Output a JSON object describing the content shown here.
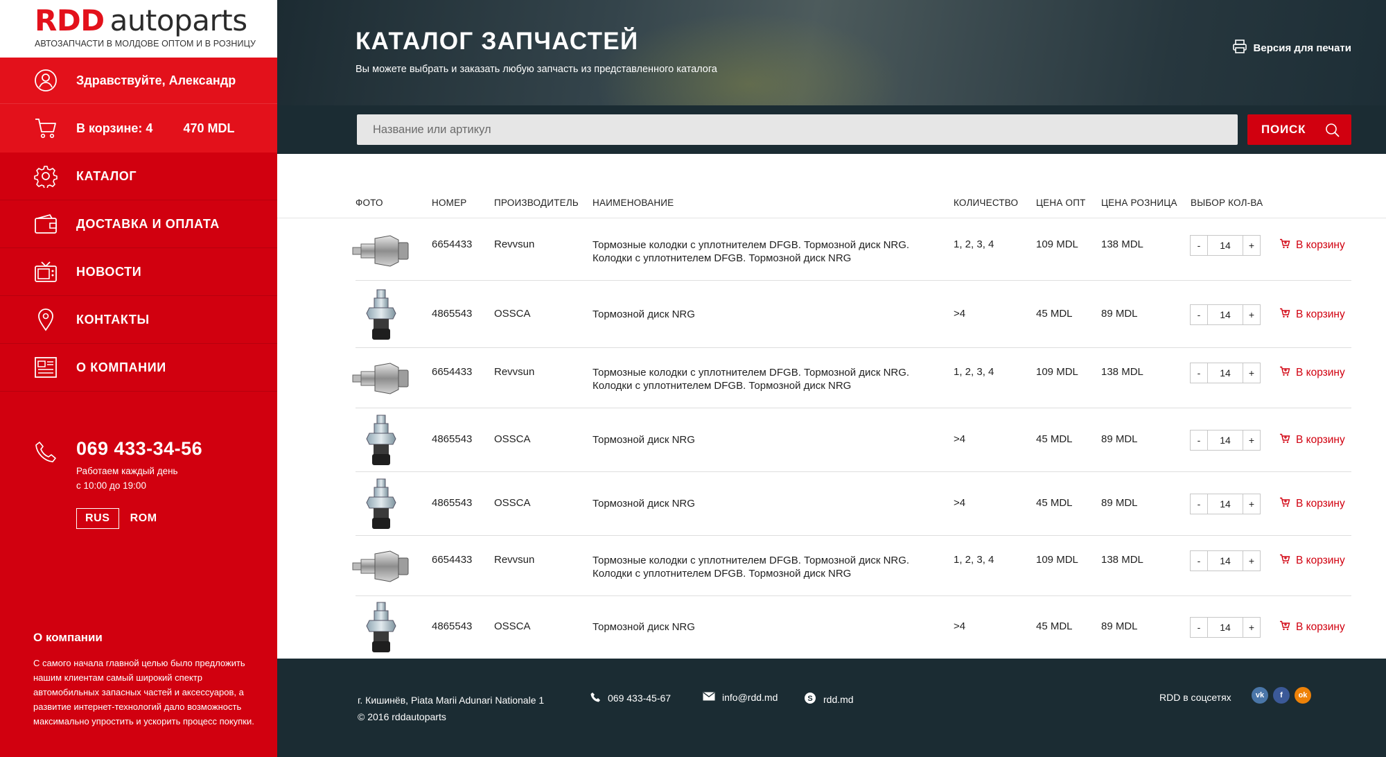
{
  "brand": {
    "name_red": "RDD",
    "name_dark": "autoparts",
    "tagline": "АВТОЗАПЧАСТИ В МОЛДОВЕ ОПТОМ И В РОЗНИЦУ"
  },
  "user": {
    "greeting": "Здравствуйте, Александр"
  },
  "cart": {
    "label": "В корзине: 4",
    "total": "470 MDL"
  },
  "menu": [
    {
      "label": "КАТАЛОГ",
      "icon": "gear-icon"
    },
    {
      "label": "ДОСТАВКА И ОПЛАТА",
      "icon": "wallet-icon"
    },
    {
      "label": "НОВОСТИ",
      "icon": "tv-icon"
    },
    {
      "label": "КОНТАКТЫ",
      "icon": "location-pin-icon"
    },
    {
      "label": "О КОМПАНИИ",
      "icon": "newspaper-icon"
    }
  ],
  "contact": {
    "phone": "069 433-34-56",
    "hours_line1": "Работаем каждый день",
    "hours_line2": "с 10:00 до 19:00"
  },
  "languages": {
    "active": "RUS",
    "other": "ROM"
  },
  "about": {
    "title": "О компании",
    "text": "С самого начала главной целью было предложить нашим клиентам самый широкий спектр автомобильных запасных частей и аксессуаров, а развитие интернет-технологий дало возможность максимально упростить и ускорить процесс покупки."
  },
  "header": {
    "title": "КАТАЛОГ ЗАПЧАСТЕЙ",
    "subtitle": "Вы можете выбрать и заказать любую запчасть из представленного каталога",
    "print_label": "Версия для печати"
  },
  "search": {
    "placeholder": "Название или артикул",
    "button_label": "ПОИСК"
  },
  "table": {
    "headers": {
      "photo": "ФОТО",
      "number": "НОМЕР",
      "maker": "ПРОИЗВОДИТЕЛЬ",
      "name": "НАИМЕНОВАНИЕ",
      "quantity": "КОЛИЧЕСТВО",
      "price_wholesale": "ЦЕНА ОПТ",
      "price_retail": "ЦЕНА РОЗНИЦА",
      "qty_select": "ВЫБОР КОЛ-ВА"
    },
    "add_to_cart_label": "В корзину",
    "rows": [
      {
        "kind": "sensor-wide",
        "number": "6654433",
        "maker": "Revvsun",
        "name_line1": "Тормозные колодки с уплотнителем DFGB. Тормозной диск NRG.",
        "name_line2": "Колодки с уплотнителем DFGB. Тормозной диск NRG",
        "quantity": "1, 2, 3, 4",
        "price_opt": "109 MDL",
        "price_retail": "138 MDL",
        "qty": "14"
      },
      {
        "kind": "sensor-tall",
        "number": "4865543",
        "maker": "OSSCA",
        "name_line1": "Тормозной диск NRG",
        "name_line2": "",
        "quantity": ">4",
        "price_opt": "45 MDL",
        "price_retail": "89 MDL",
        "qty": "14"
      },
      {
        "kind": "sensor-wide",
        "number": "6654433",
        "maker": "Revvsun",
        "name_line1": "Тормозные колодки с уплотнителем DFGB. Тормозной диск NRG.",
        "name_line2": "Колодки с уплотнителем DFGB. Тормозной диск NRG",
        "quantity": "1, 2, 3, 4",
        "price_opt": "109 MDL",
        "price_retail": "138 MDL",
        "qty": "14"
      },
      {
        "kind": "sensor-tall",
        "number": "4865543",
        "maker": "OSSCA",
        "name_line1": "Тормозной диск NRG",
        "name_line2": "",
        "quantity": ">4",
        "price_opt": "45 MDL",
        "price_retail": "89 MDL",
        "qty": "14"
      },
      {
        "kind": "sensor-tall",
        "number": "4865543",
        "maker": "OSSCA",
        "name_line1": "Тормозной диск NRG",
        "name_line2": "",
        "quantity": ">4",
        "price_opt": "45 MDL",
        "price_retail": "89 MDL",
        "qty": "14"
      },
      {
        "kind": "sensor-wide",
        "number": "6654433",
        "maker": "Revvsun",
        "name_line1": "Тормозные колодки с уплотнителем DFGB. Тормозной диск NRG.",
        "name_line2": "Колодки с уплотнителем DFGB. Тормозной диск NRG",
        "quantity": "1, 2, 3, 4",
        "price_opt": "109 MDL",
        "price_retail": "138 MDL",
        "qty": "14"
      },
      {
        "kind": "sensor-tall",
        "number": "4865543",
        "maker": "OSSCA",
        "name_line1": "Тормозной диск NRG",
        "name_line2": "",
        "quantity": ">4",
        "price_opt": "45 MDL",
        "price_retail": "89 MDL",
        "qty": "14"
      }
    ]
  },
  "footer": {
    "address": "г. Кишинёв, Piata Marii Adunari Nationale 1",
    "copyright": "© 2016 rddautoparts",
    "phone": "069 433-45-67",
    "email": "info@rdd.md",
    "skype": "rdd.md",
    "social_label": "RDD в соцсетях",
    "social": [
      {
        "name": "vk-icon",
        "glyph": "vk",
        "color": "#4a76a8"
      },
      {
        "name": "facebook-icon",
        "glyph": "f",
        "color": "#3b5998"
      },
      {
        "name": "odnoklassniki-icon",
        "glyph": "ok",
        "color": "#ee8208"
      }
    ]
  },
  "colors": {
    "brand_red": "#e3111b",
    "sidebar_red": "#d1000f",
    "dark": "#1b2c33"
  }
}
